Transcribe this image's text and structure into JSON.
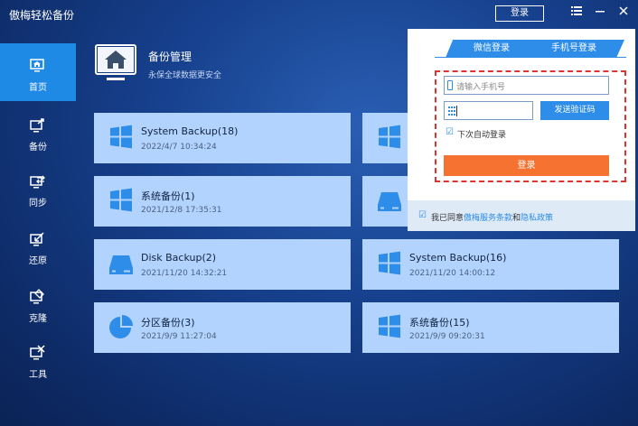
{
  "titlebar": {
    "title": "傲梅轻松备份",
    "login_label": "登录",
    "menu_icon": "menu-icon",
    "minimize_icon": "minimize-icon",
    "close_icon": "close-icon"
  },
  "sidebar": {
    "items": [
      {
        "label": "首页",
        "icon": "home-icon",
        "active": true
      },
      {
        "label": "备份",
        "icon": "backup-icon",
        "active": false
      },
      {
        "label": "同步",
        "icon": "sync-icon",
        "active": false
      },
      {
        "label": "还原",
        "icon": "restore-icon",
        "active": false
      },
      {
        "label": "克隆",
        "icon": "clone-icon",
        "active": false
      },
      {
        "label": "工具",
        "icon": "tools-icon",
        "active": false
      }
    ]
  },
  "header": {
    "title": "备份管理",
    "subtitle": "永保全球数据更安全"
  },
  "cards": [
    {
      "title": "System Backup(18)",
      "date": "2022/4/7 10:34:24",
      "icon": "windows-icon"
    },
    {
      "title": "系统备份(1)",
      "date": "2021/12/8 17:35:31",
      "icon": "windows-icon"
    },
    {
      "title": "Disk Backup(2)",
      "date": "2021/11/20 14:32:21",
      "icon": "disk-icon"
    },
    {
      "title": "System Backup(16)",
      "date": "2021/11/20 14:00:12",
      "icon": "windows-icon"
    },
    {
      "title": "分区备份(3)",
      "date": "2021/9/9 11:27:04",
      "icon": "partition-icon"
    },
    {
      "title": "系统备份(15)",
      "date": "2021/9/9 09:20:31",
      "icon": "windows-icon"
    }
  ],
  "login_popup": {
    "tabs": [
      "微信登录",
      "手机号登录"
    ],
    "phone_placeholder": "请输入手机号",
    "send_code_label": "发送验证码",
    "remember_label": "下次自动登录",
    "submit_label": "登录",
    "agree_prefix": "我已同意",
    "terms_link": "傲梅服务条款",
    "and_text": "和",
    "privacy_link": "隐私政策"
  },
  "colors": {
    "accent": "#2d8de8",
    "submit": "#f57230",
    "card_bg": "#b3d3ff",
    "highlight_border": "#e0322f"
  }
}
